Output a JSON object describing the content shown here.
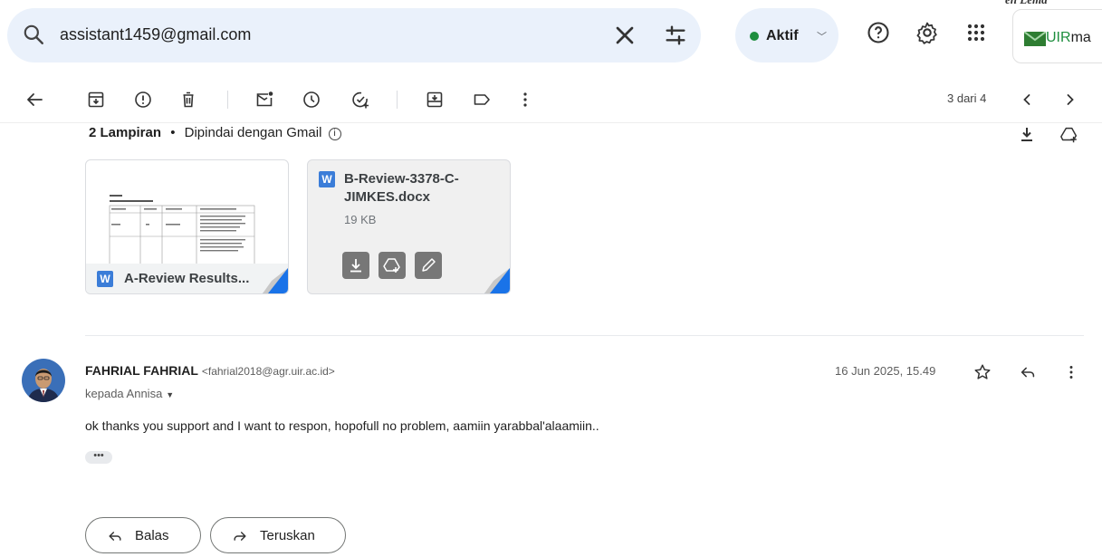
{
  "search": {
    "query": "assistant1459@gmail.com"
  },
  "status": {
    "label": "Aktif",
    "color": "#1e8e3e"
  },
  "org": {
    "label_green": "UIR",
    "label_rest": "ma"
  },
  "corner_text": "en Lema",
  "toolbar": {
    "pager": "3 dari 4"
  },
  "attachments": {
    "count_label": "2 Lampiran",
    "separator": "•",
    "scanned_label": "Dipindai dengan Gmail",
    "files": [
      {
        "name": "A-Review Results...",
        "type_icon": "W"
      },
      {
        "name_line1": "B-Review-3378-C-",
        "name_line2": "JIMKES.docx",
        "size": "19 KB",
        "type_icon": "W"
      }
    ]
  },
  "message": {
    "sender_name": "FAHRIAL FAHRIAL",
    "sender_email": "<fahrial2018@agr.uir.ac.id>",
    "recipient": "kepada Annisa",
    "date": "16 Jun 2025, 15.49",
    "body": "ok thanks you support and I want to respon, hopofull no problem, aamiin yarabbal'alaamiin..",
    "more": "•••"
  },
  "actions": {
    "reply": "Balas",
    "forward": "Teruskan"
  },
  "icons": [
    "search-icon",
    "close-icon",
    "filter-icon",
    "help-icon",
    "settings-icon",
    "apps-icon",
    "mail-icon",
    "back-icon",
    "archive-icon",
    "report-spam-icon",
    "delete-icon",
    "mark-unread-icon",
    "snooze-icon",
    "add-task-icon",
    "move-to-icon",
    "label-icon",
    "more-icon",
    "prev-icon",
    "next-icon",
    "download-icon",
    "drive-icon",
    "edit-icon",
    "star-icon",
    "reply-icon"
  ]
}
